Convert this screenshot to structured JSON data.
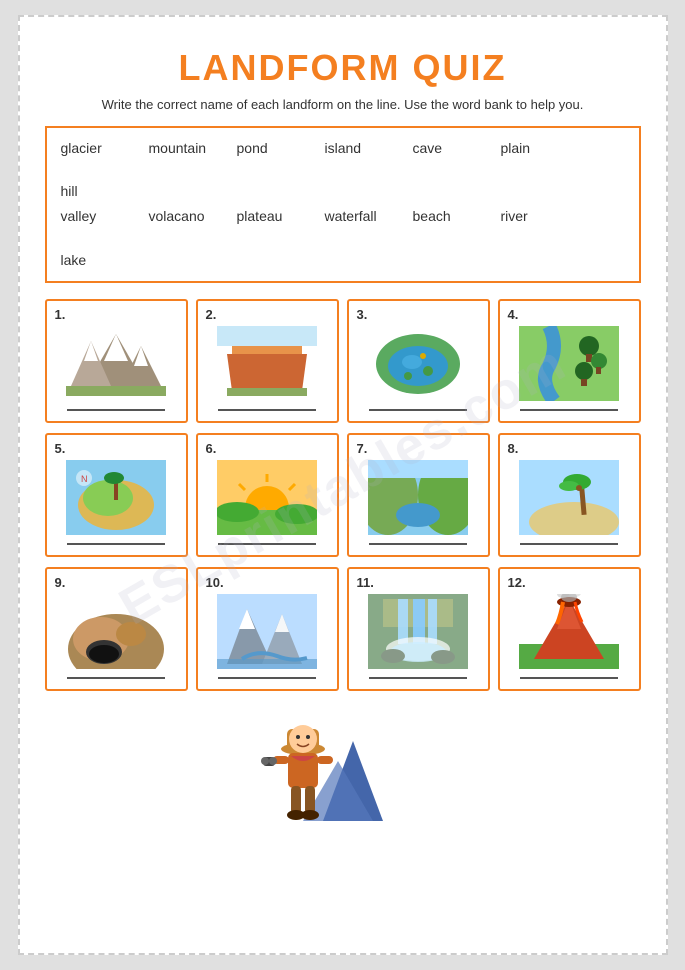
{
  "page": {
    "title": "LANDFORM QUIZ",
    "instruction": "Write the correct name of each landform on the line. Use the word bank to help you.",
    "word_bank": {
      "row1": [
        "glacier",
        "mountain",
        "pond",
        "island",
        "cave",
        "plain",
        "hill"
      ],
      "row2": [
        "valley",
        "volacano",
        "plateau",
        "waterfall",
        "beach",
        "river",
        "lake"
      ]
    },
    "cards": [
      {
        "number": "1.",
        "type": "mountain"
      },
      {
        "number": "2.",
        "type": "plateau"
      },
      {
        "number": "3.",
        "type": "pond"
      },
      {
        "number": "4.",
        "type": "river"
      },
      {
        "number": "5.",
        "type": "island"
      },
      {
        "number": "6.",
        "type": "plain"
      },
      {
        "number": "7.",
        "type": "valley"
      },
      {
        "number": "8.",
        "type": "beach"
      },
      {
        "number": "9.",
        "type": "cave"
      },
      {
        "number": "10.",
        "type": "glacier"
      },
      {
        "number": "11.",
        "type": "waterfall"
      },
      {
        "number": "12.",
        "type": "volcano"
      }
    ],
    "watermark": "ESLprintables.com"
  }
}
